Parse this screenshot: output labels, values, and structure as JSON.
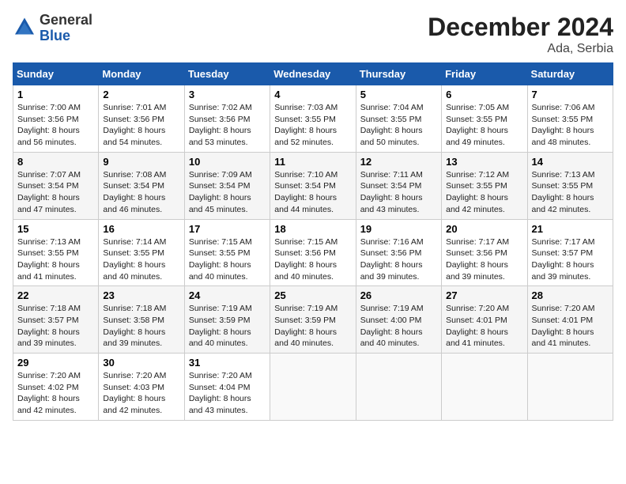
{
  "header": {
    "logo_general": "General",
    "logo_blue": "Blue",
    "month_title": "December 2024",
    "location": "Ada, Serbia"
  },
  "days_of_week": [
    "Sunday",
    "Monday",
    "Tuesday",
    "Wednesday",
    "Thursday",
    "Friday",
    "Saturday"
  ],
  "weeks": [
    [
      {
        "day": "1",
        "info": "Sunrise: 7:00 AM\nSunset: 3:56 PM\nDaylight: 8 hours\nand 56 minutes."
      },
      {
        "day": "2",
        "info": "Sunrise: 7:01 AM\nSunset: 3:56 PM\nDaylight: 8 hours\nand 54 minutes."
      },
      {
        "day": "3",
        "info": "Sunrise: 7:02 AM\nSunset: 3:56 PM\nDaylight: 8 hours\nand 53 minutes."
      },
      {
        "day": "4",
        "info": "Sunrise: 7:03 AM\nSunset: 3:55 PM\nDaylight: 8 hours\nand 52 minutes."
      },
      {
        "day": "5",
        "info": "Sunrise: 7:04 AM\nSunset: 3:55 PM\nDaylight: 8 hours\nand 50 minutes."
      },
      {
        "day": "6",
        "info": "Sunrise: 7:05 AM\nSunset: 3:55 PM\nDaylight: 8 hours\nand 49 minutes."
      },
      {
        "day": "7",
        "info": "Sunrise: 7:06 AM\nSunset: 3:55 PM\nDaylight: 8 hours\nand 48 minutes."
      }
    ],
    [
      {
        "day": "8",
        "info": "Sunrise: 7:07 AM\nSunset: 3:54 PM\nDaylight: 8 hours\nand 47 minutes."
      },
      {
        "day": "9",
        "info": "Sunrise: 7:08 AM\nSunset: 3:54 PM\nDaylight: 8 hours\nand 46 minutes."
      },
      {
        "day": "10",
        "info": "Sunrise: 7:09 AM\nSunset: 3:54 PM\nDaylight: 8 hours\nand 45 minutes."
      },
      {
        "day": "11",
        "info": "Sunrise: 7:10 AM\nSunset: 3:54 PM\nDaylight: 8 hours\nand 44 minutes."
      },
      {
        "day": "12",
        "info": "Sunrise: 7:11 AM\nSunset: 3:54 PM\nDaylight: 8 hours\nand 43 minutes."
      },
      {
        "day": "13",
        "info": "Sunrise: 7:12 AM\nSunset: 3:55 PM\nDaylight: 8 hours\nand 42 minutes."
      },
      {
        "day": "14",
        "info": "Sunrise: 7:13 AM\nSunset: 3:55 PM\nDaylight: 8 hours\nand 42 minutes."
      }
    ],
    [
      {
        "day": "15",
        "info": "Sunrise: 7:13 AM\nSunset: 3:55 PM\nDaylight: 8 hours\nand 41 minutes."
      },
      {
        "day": "16",
        "info": "Sunrise: 7:14 AM\nSunset: 3:55 PM\nDaylight: 8 hours\nand 40 minutes."
      },
      {
        "day": "17",
        "info": "Sunrise: 7:15 AM\nSunset: 3:55 PM\nDaylight: 8 hours\nand 40 minutes."
      },
      {
        "day": "18",
        "info": "Sunrise: 7:15 AM\nSunset: 3:56 PM\nDaylight: 8 hours\nand 40 minutes."
      },
      {
        "day": "19",
        "info": "Sunrise: 7:16 AM\nSunset: 3:56 PM\nDaylight: 8 hours\nand 39 minutes."
      },
      {
        "day": "20",
        "info": "Sunrise: 7:17 AM\nSunset: 3:56 PM\nDaylight: 8 hours\nand 39 minutes."
      },
      {
        "day": "21",
        "info": "Sunrise: 7:17 AM\nSunset: 3:57 PM\nDaylight: 8 hours\nand 39 minutes."
      }
    ],
    [
      {
        "day": "22",
        "info": "Sunrise: 7:18 AM\nSunset: 3:57 PM\nDaylight: 8 hours\nand 39 minutes."
      },
      {
        "day": "23",
        "info": "Sunrise: 7:18 AM\nSunset: 3:58 PM\nDaylight: 8 hours\nand 39 minutes."
      },
      {
        "day": "24",
        "info": "Sunrise: 7:19 AM\nSunset: 3:59 PM\nDaylight: 8 hours\nand 40 minutes."
      },
      {
        "day": "25",
        "info": "Sunrise: 7:19 AM\nSunset: 3:59 PM\nDaylight: 8 hours\nand 40 minutes."
      },
      {
        "day": "26",
        "info": "Sunrise: 7:19 AM\nSunset: 4:00 PM\nDaylight: 8 hours\nand 40 minutes."
      },
      {
        "day": "27",
        "info": "Sunrise: 7:20 AM\nSunset: 4:01 PM\nDaylight: 8 hours\nand 41 minutes."
      },
      {
        "day": "28",
        "info": "Sunrise: 7:20 AM\nSunset: 4:01 PM\nDaylight: 8 hours\nand 41 minutes."
      }
    ],
    [
      {
        "day": "29",
        "info": "Sunrise: 7:20 AM\nSunset: 4:02 PM\nDaylight: 8 hours\nand 42 minutes."
      },
      {
        "day": "30",
        "info": "Sunrise: 7:20 AM\nSunset: 4:03 PM\nDaylight: 8 hours\nand 42 minutes."
      },
      {
        "day": "31",
        "info": "Sunrise: 7:20 AM\nSunset: 4:04 PM\nDaylight: 8 hours\nand 43 minutes."
      },
      {
        "day": "",
        "info": ""
      },
      {
        "day": "",
        "info": ""
      },
      {
        "day": "",
        "info": ""
      },
      {
        "day": "",
        "info": ""
      }
    ]
  ]
}
